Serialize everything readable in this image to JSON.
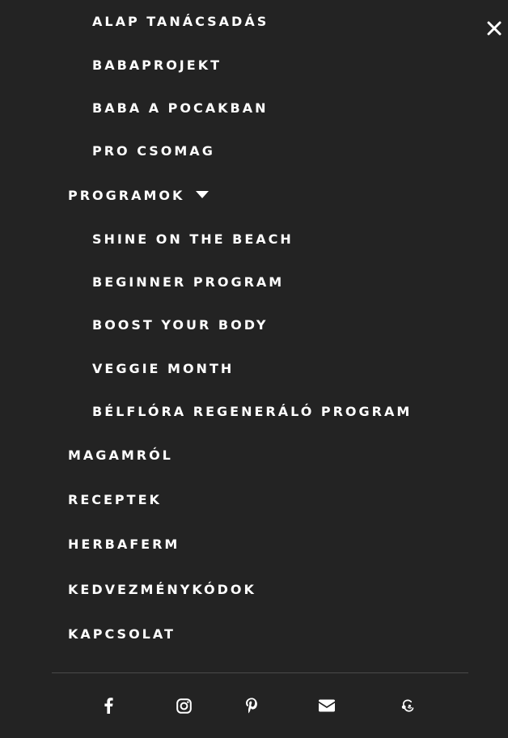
{
  "close_label": "×",
  "submenu_items": [
    "ALAP TANÁCSADÁS",
    "BABAPROJEKT",
    "BABA A POCAKBAN",
    "PRO CSOMAG"
  ],
  "programs": {
    "label": "PROGRAMOK",
    "items": [
      "SHINE ON THE BEACH",
      "BEGINNER PROGRAM",
      "BOOST YOUR BODY",
      "VEGGIE MONTH",
      "BÉLFLÓRA REGENERÁLÓ PROGRAM"
    ]
  },
  "main_items": [
    "MAGAMRÓL",
    "RECEPTEK",
    "HERBAFERM",
    "KEDVEZMÉNYKÓDOK",
    "KAPCSOLAT"
  ],
  "social": [
    {
      "name": "facebook-icon"
    },
    {
      "name": "instagram-icon"
    },
    {
      "name": "pinterest-icon"
    },
    {
      "name": "envelope-icon"
    },
    {
      "name": "mailchimp-icon"
    }
  ],
  "colors": {
    "background": "#232323",
    "text": "#ffffff",
    "divider": "#4a4a4a"
  }
}
